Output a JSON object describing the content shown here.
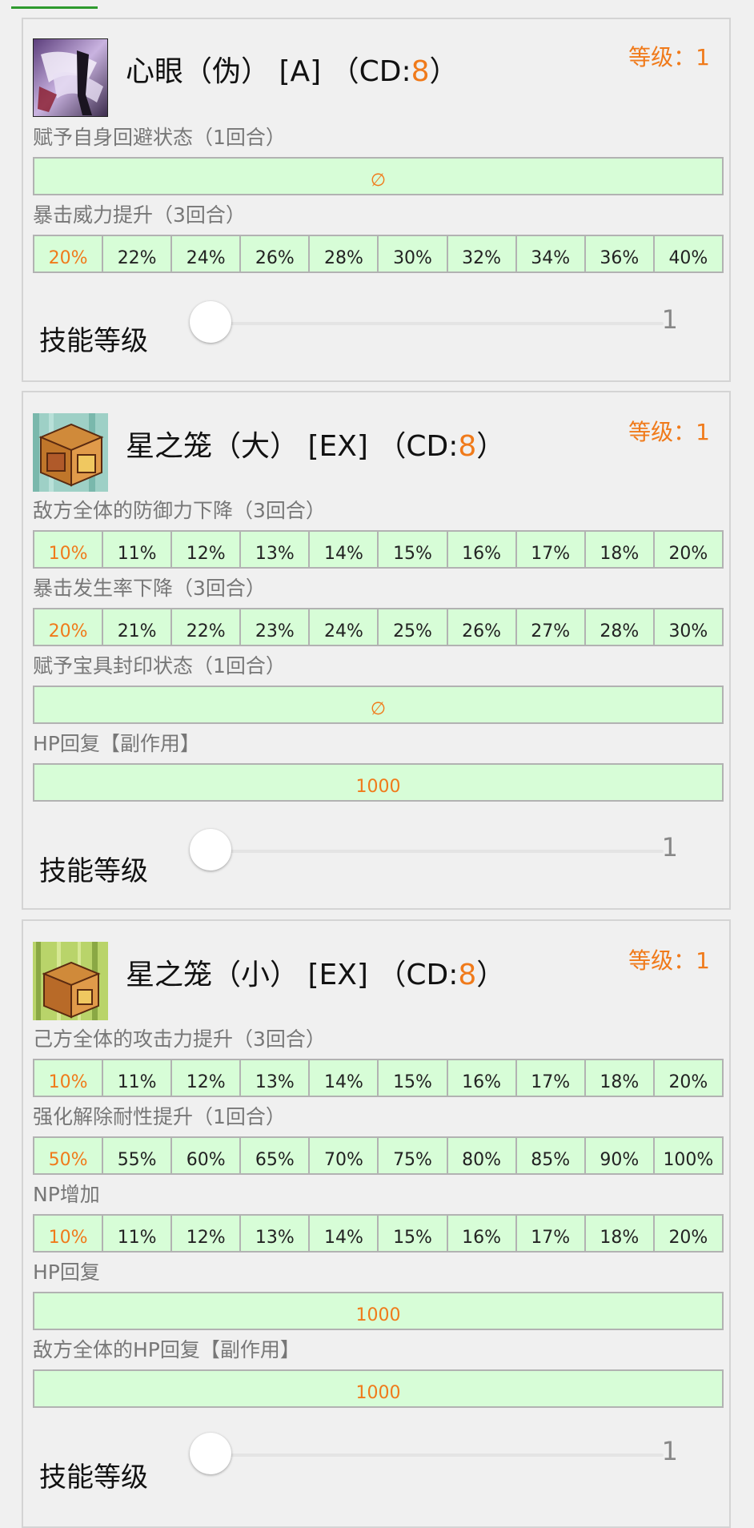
{
  "skills": [
    {
      "title_prefix": "心眼（伪） [A] （CD:",
      "cd": "8",
      "title_suffix": "）",
      "level_label": "等级：1",
      "effects": [
        {
          "label": "赋予自身回避状态（1回合）",
          "full": "∅"
        },
        {
          "label": "暴击威力提升（3回合）",
          "values": [
            "20%",
            "22%",
            "24%",
            "26%",
            "28%",
            "30%",
            "32%",
            "34%",
            "36%",
            "40%"
          ]
        }
      ],
      "slider": {
        "label": "技能等级",
        "value": "1",
        "level_fraction": 0
      }
    },
    {
      "title_prefix": "星之笼（大） [EX] （CD:",
      "cd": "8",
      "title_suffix": "）",
      "level_label": "等级：1",
      "effects": [
        {
          "label": "敌方全体的防御力下降（3回合）",
          "values": [
            "10%",
            "11%",
            "12%",
            "13%",
            "14%",
            "15%",
            "16%",
            "17%",
            "18%",
            "20%"
          ]
        },
        {
          "label": "暴击发生率下降（3回合）",
          "values": [
            "20%",
            "21%",
            "22%",
            "23%",
            "24%",
            "25%",
            "26%",
            "27%",
            "28%",
            "30%"
          ]
        },
        {
          "label": "赋予宝具封印状态（1回合）",
          "full": "∅"
        },
        {
          "label": "HP回复【副作用】",
          "full": "1000"
        }
      ],
      "slider": {
        "label": "技能等级",
        "value": "1",
        "level_fraction": 0
      }
    },
    {
      "title_prefix": "星之笼（小） [EX] （CD:",
      "cd": "8",
      "title_suffix": "）",
      "level_label": "等级：1",
      "effects": [
        {
          "label": "己方全体的攻击力提升（3回合）",
          "values": [
            "10%",
            "11%",
            "12%",
            "13%",
            "14%",
            "15%",
            "16%",
            "17%",
            "18%",
            "20%"
          ]
        },
        {
          "label": "强化解除耐性提升（1回合）",
          "values": [
            "50%",
            "55%",
            "60%",
            "65%",
            "70%",
            "75%",
            "80%",
            "85%",
            "90%",
            "100%"
          ]
        },
        {
          "label": "NP增加",
          "values": [
            "10%",
            "11%",
            "12%",
            "13%",
            "14%",
            "15%",
            "16%",
            "17%",
            "18%",
            "20%"
          ]
        },
        {
          "label": "HP回复",
          "full": "1000"
        },
        {
          "label": "敌方全体的HP回复【副作用】",
          "full": "1000"
        }
      ],
      "slider": {
        "label": "技能等级",
        "value": "1",
        "level_fraction": 0
      }
    }
  ],
  "colors": {
    "accent": "#f07a1a",
    "cell_bg": "#d7fdd7",
    "cell_border": "#b2b2b2",
    "page_bg": "#f0f0f0",
    "tab_indicator": "#2e9a2e"
  },
  "icons": [
    "skill-icon-eye-of-mind",
    "skill-icon-star-cage-large",
    "skill-icon-star-cage-small"
  ]
}
